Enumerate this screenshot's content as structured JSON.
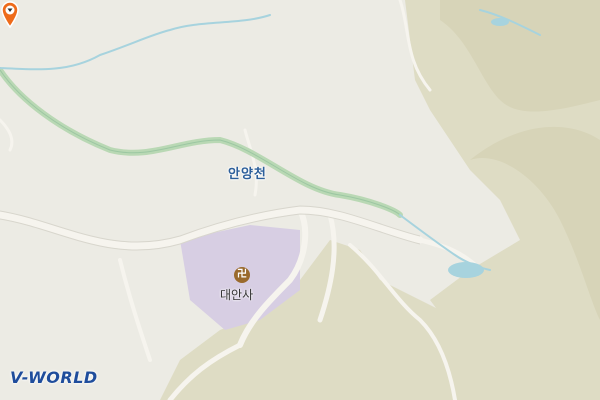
{
  "map": {
    "river_label": "안양천",
    "poi": {
      "name": "대안사",
      "icon": "temple-icon",
      "glyph": "卍"
    },
    "marker": {
      "icon": "location-pin-icon",
      "color": "#ee6b1a"
    },
    "logo": "V-WORLD",
    "colors": {
      "background": "#ecebe4",
      "terrain": "#dedcc4",
      "river": "#b9d8b4",
      "stream": "#a7d3de",
      "road": "#f6f4ee",
      "building": "#d7cee3",
      "brand": "#1f4d9c"
    }
  }
}
